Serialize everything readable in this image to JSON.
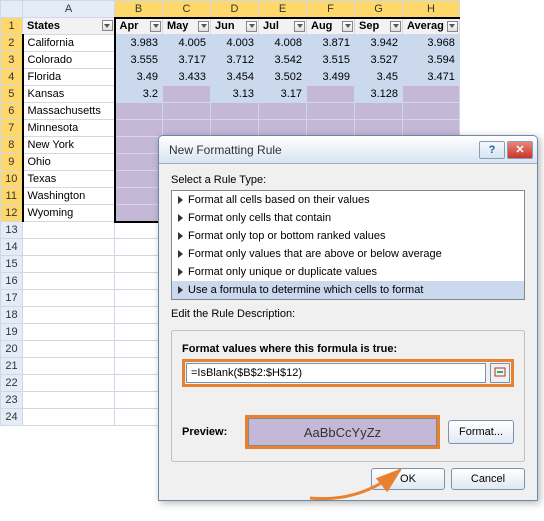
{
  "columns": [
    "A",
    "B",
    "C",
    "D",
    "E",
    "F",
    "G",
    "H"
  ],
  "header_row": {
    "A": "States",
    "B": "Apr",
    "C": "May",
    "D": "Jun",
    "E": "Jul",
    "F": "Aug",
    "G": "Sep",
    "H": "Averag"
  },
  "states": [
    "California",
    "Colorado",
    "Florida",
    "Kansas",
    "Massachusetts",
    "Minnesota",
    "New York",
    "Ohio",
    "Texas",
    "Washington",
    "Wyoming"
  ],
  "data": [
    [
      "3.983",
      "4.005",
      "4.003",
      "4.008",
      "3.871",
      "3.942",
      "3.968"
    ],
    [
      "3.555",
      "3.717",
      "3.712",
      "3.542",
      "3.515",
      "3.527",
      "3.594"
    ],
    [
      "3.49",
      "3.433",
      "3.454",
      "3.502",
      "3.499",
      "3.45",
      "3.471"
    ],
    [
      "3.2",
      "",
      "3.13",
      "3.17",
      "",
      "3.128",
      ""
    ],
    [
      "",
      "",
      "",
      "",
      "",
      "",
      ""
    ],
    [
      "",
      "",
      "",
      "",
      "",
      "",
      ""
    ],
    [
      "",
      "",
      "",
      "",
      "",
      "",
      ""
    ],
    [
      "",
      "",
      "",
      "",
      "",
      "",
      ""
    ],
    [
      "",
      "",
      "",
      "",
      "",
      "",
      ""
    ],
    [
      "",
      "",
      "",
      "",
      "",
      "",
      ""
    ],
    [
      "",
      "",
      "",
      "",
      "",
      "",
      ""
    ]
  ],
  "dialog": {
    "title": "New Formatting Rule",
    "select_label": "Select a Rule Type:",
    "rule_types": [
      "Format all cells based on their values",
      "Format only cells that contain",
      "Format only top or bottom ranked values",
      "Format only values that are above or below average",
      "Format only unique or duplicate values",
      "Use a formula to determine which cells to format"
    ],
    "edit_label": "Edit the Rule Description:",
    "formula_label": "Format values where this formula is true:",
    "formula_value": "=IsBlank($B$2:$H$12)",
    "preview_label": "Preview:",
    "preview_text": "AaBbCcYyZz",
    "format_btn": "Format...",
    "ok": "OK",
    "cancel": "Cancel"
  }
}
